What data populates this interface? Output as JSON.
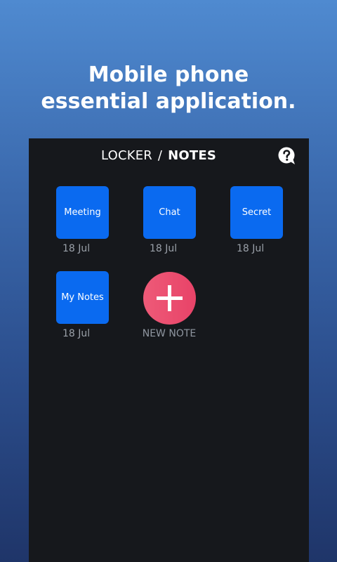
{
  "promo": {
    "line1": "Mobile phone",
    "line2": "essential application."
  },
  "header": {
    "title_left": "LOCKER",
    "title_sep": "/",
    "title_right": "NOTES",
    "help_icon": "question-bubble-icon"
  },
  "notes": [
    {
      "label": "Meeting",
      "date": "18 Jul"
    },
    {
      "label": "Chat",
      "date": "18 Jul"
    },
    {
      "label": "Secret",
      "date": "18 Jul"
    },
    {
      "label": "My Notes",
      "date": "18 Jul"
    }
  ],
  "new_note": {
    "label": "NEW NOTE",
    "icon": "plus-icon"
  },
  "colors": {
    "tile": "#0a6af0",
    "new_note": "#e84368",
    "screen_bg": "#16181c"
  }
}
